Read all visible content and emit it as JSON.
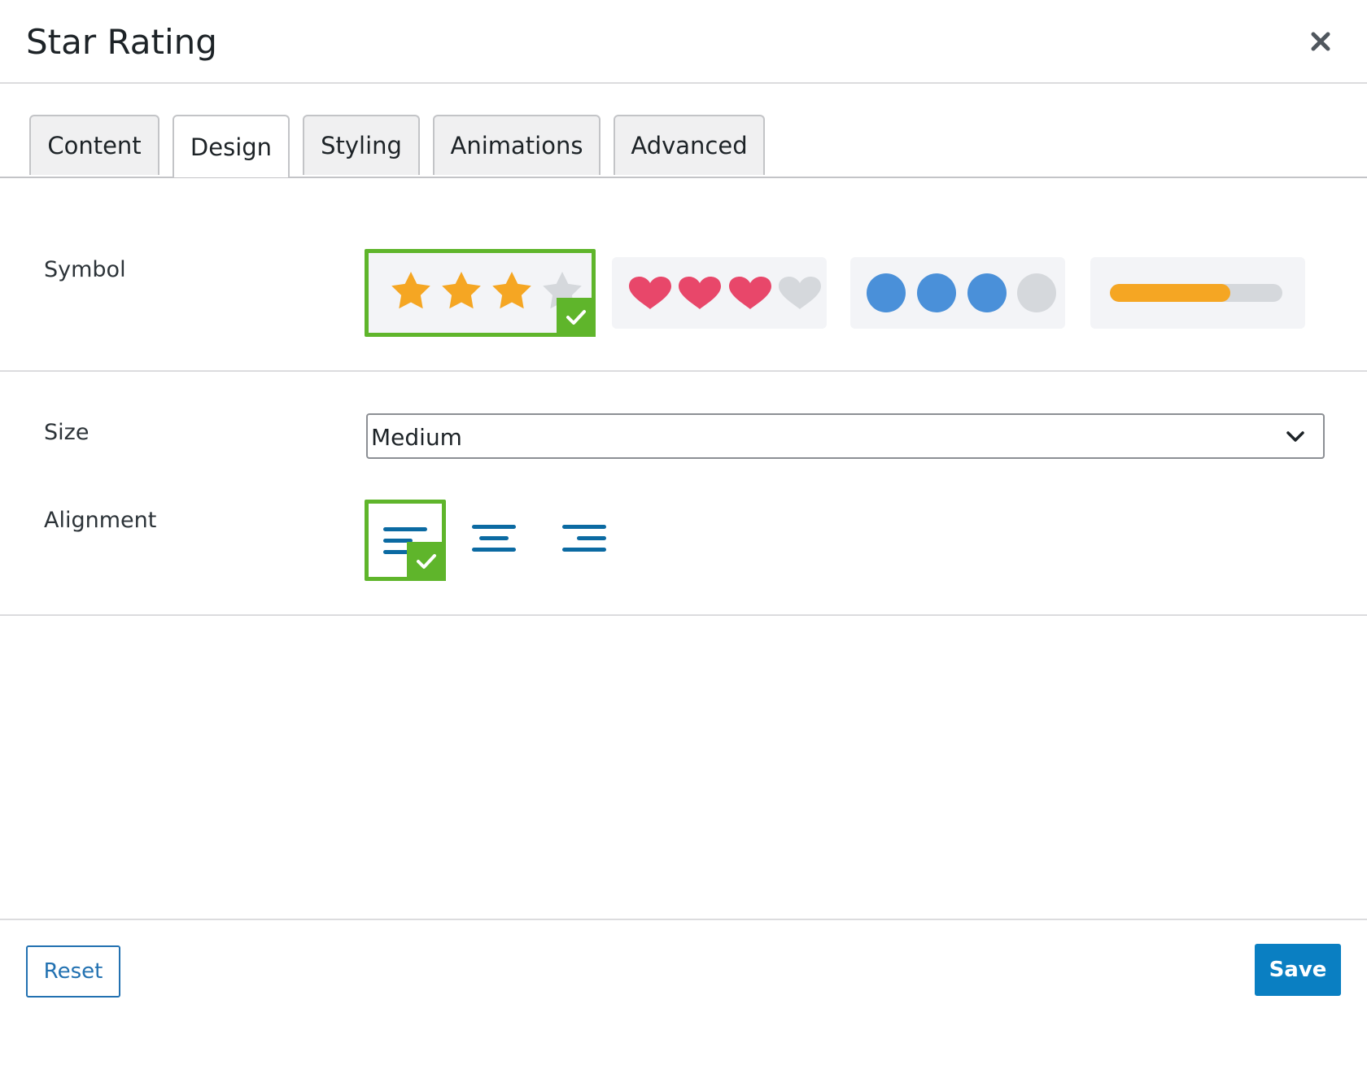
{
  "dialog": {
    "title": "Star Rating",
    "close_icon": "close-icon"
  },
  "tabs": [
    {
      "label": "Content",
      "active": false
    },
    {
      "label": "Design",
      "active": true
    },
    {
      "label": "Styling",
      "active": false
    },
    {
      "label": "Animations",
      "active": false
    },
    {
      "label": "Advanced",
      "active": false
    }
  ],
  "symbol": {
    "label": "Symbol",
    "options": [
      {
        "type": "stars",
        "icon": "star-icon",
        "filled": 3,
        "total": 4,
        "selected": true
      },
      {
        "type": "hearts",
        "icon": "heart-icon",
        "filled": 3,
        "total": 4,
        "selected": false
      },
      {
        "type": "circles",
        "icon": "circle-icon",
        "filled": 3,
        "total": 4,
        "selected": false
      },
      {
        "type": "bar",
        "icon": "progress-bar-icon",
        "fill_fraction": 0.7,
        "selected": false
      }
    ]
  },
  "size": {
    "label": "Size",
    "value": "Medium"
  },
  "alignment": {
    "label": "Alignment",
    "options": [
      {
        "value": "left",
        "icon": "align-left-icon",
        "selected": true
      },
      {
        "value": "center",
        "icon": "align-center-icon",
        "selected": false
      },
      {
        "value": "right",
        "icon": "align-right-icon",
        "selected": false
      }
    ]
  },
  "footer": {
    "reset_label": "Reset",
    "save_label": "Save"
  },
  "colors": {
    "selected_border": "#5fb52b",
    "star": "#f5a623",
    "heart": "#e8476a",
    "circle": "#4a90d9",
    "empty": "#d5d8dc",
    "align_icon": "#0b6aa2",
    "save_bg": "#0a7fc2",
    "reset_text": "#2271b1"
  }
}
